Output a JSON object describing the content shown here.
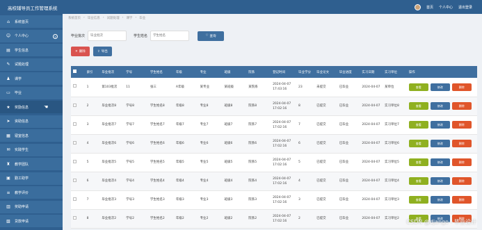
{
  "header": {
    "title": "高校辅导员工作管理系统",
    "links": [
      "首页",
      "个人中心",
      "退出登录"
    ]
  },
  "sidebar": {
    "items": [
      {
        "label": "系统首页",
        "icon": "home-icon",
        "glyph": "⌂"
      },
      {
        "label": "个人中心",
        "icon": "user-icon",
        "glyph": "☺",
        "expand": "v"
      },
      {
        "label": "学生信息",
        "icon": "id-card-icon",
        "glyph": "▤"
      },
      {
        "label": "试题处理",
        "icon": "pencil-icon",
        "glyph": "✎"
      },
      {
        "label": "课学",
        "icon": "person-icon",
        "glyph": "♟"
      },
      {
        "label": "毕业",
        "icon": "monitor-icon",
        "glyph": "▭"
      },
      {
        "label": "奖励信息",
        "icon": "star-icon",
        "glyph": "★"
      },
      {
        "label": "资助信息",
        "icon": "send-icon",
        "glyph": "➤"
      },
      {
        "label": "寝室信息",
        "icon": "building-icon",
        "glyph": "▦"
      },
      {
        "label": "实践学生",
        "icon": "mail-icon",
        "glyph": "✉"
      },
      {
        "label": "教学团队",
        "icon": "team-icon",
        "glyph": "♜"
      },
      {
        "label": "勤工助学",
        "icon": "briefcase-icon",
        "glyph": "▣"
      },
      {
        "label": "教学评价",
        "icon": "list-icon",
        "glyph": "≡"
      },
      {
        "label": "奖助申请",
        "icon": "doc-icon",
        "glyph": "▥"
      },
      {
        "label": "贷款申请",
        "icon": "calendar-icon",
        "glyph": "▧"
      }
    ]
  },
  "breadcrumb": [
    "系统首页",
    "毕业信息",
    "试题处理",
    "课学",
    "毕业"
  ],
  "search": {
    "batch_label": "毕业批次",
    "batch_placeholder": "毕业批次",
    "name_label": "学生姓名",
    "name_placeholder": "学生姓名",
    "search_button": "查询"
  },
  "toolbar": {
    "delete_label": "删除",
    "export_label": "导出"
  },
  "table": {
    "columns": [
      "索引",
      "毕业批次",
      "学号",
      "学生姓名",
      "年级",
      "专业",
      "班级",
      "院系",
      "登记时间",
      "毕业学分",
      "毕业论文",
      "毕业进度",
      "实习日期",
      "实习单位",
      "操作"
    ],
    "actions": {
      "view": "查看",
      "edit": "修改",
      "delete": "删除"
    },
    "rows": [
      [
        "1",
        "第103批次",
        "11",
        "张三",
        "A年级",
        "某专业",
        "某班级",
        "某院系",
        "2024-04-07 17:43:16",
        "23",
        "未提交",
        "已毕业",
        "2024-04-07",
        "某单位"
      ],
      [
        "2",
        "毕业批次8",
        "学号8",
        "学生姓名8",
        "年级8",
        "专业8",
        "班级8",
        "院系8",
        "2024-04-07 17:02:16",
        "8",
        "已提交",
        "已毕业",
        "2024-04-07",
        "实习单位8"
      ],
      [
        "3",
        "毕业批次7",
        "学号7",
        "学生姓名7",
        "年级7",
        "专业7",
        "班级7",
        "院系7",
        "2024-04-07 17:02:16",
        "7",
        "已提交",
        "已毕业",
        "2024-04-07",
        "实习单位7"
      ],
      [
        "4",
        "毕业批次6",
        "学号6",
        "学生姓名6",
        "年级6",
        "专业6",
        "班级6",
        "院系6",
        "2024-04-07 17:02:16",
        "6",
        "已提交",
        "已毕业",
        "2024-04-07",
        "实习单位6"
      ],
      [
        "5",
        "毕业批次5",
        "学号5",
        "学生姓名5",
        "年级5",
        "专业5",
        "班级5",
        "院系5",
        "2024-04-07 17:02:16",
        "5",
        "已提交",
        "已毕业",
        "2024-04-07",
        "实习单位5"
      ],
      [
        "6",
        "毕业批次4",
        "学号4",
        "学生姓名4",
        "年级4",
        "专业4",
        "班级4",
        "院系4",
        "2024-04-07 17:02:16",
        "4",
        "已提交",
        "已毕业",
        "2024-04-07",
        "实习单位4"
      ],
      [
        "7",
        "毕业批次3",
        "学号3",
        "学生姓名3",
        "年级3",
        "专业3",
        "班级3",
        "院系3",
        "2024-04-07 17:02:16",
        "3",
        "已提交",
        "已毕业",
        "2024-04-07",
        "实习单位3"
      ],
      [
        "8",
        "毕业批次2",
        "学号2",
        "学生姓名2",
        "年级2",
        "专业2",
        "班级2",
        "院系2",
        "2024-04-07 17:02:16",
        "2",
        "已提交",
        "已毕业",
        "2024-04-07",
        "实习单位2"
      ]
    ]
  },
  "watermark": "CSDN @django - 毕业设计"
}
